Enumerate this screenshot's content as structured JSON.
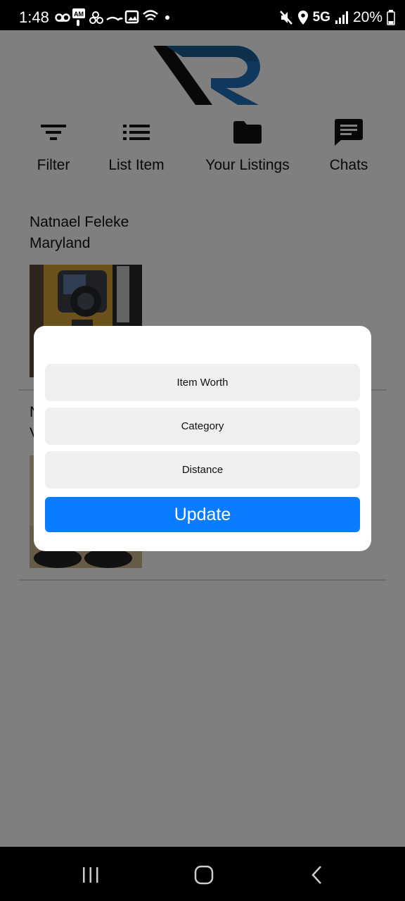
{
  "status_bar": {
    "time": "1:48",
    "network": "5G",
    "battery": "20%"
  },
  "nav": {
    "items": [
      {
        "label": "Filter",
        "icon": "filter-icon"
      },
      {
        "label": "List Item",
        "icon": "list-icon"
      },
      {
        "label": "Your Listings",
        "icon": "folder-icon"
      },
      {
        "label": "Chats",
        "icon": "chat-icon"
      }
    ]
  },
  "listings": [
    {
      "name": "Natnael Feleke",
      "location": "Maryland",
      "image": "camera-box photo"
    },
    {
      "name": "N",
      "location": "V",
      "image": "shoes photo"
    }
  ],
  "filter_dialog": {
    "options": [
      "Item Worth",
      "Category",
      "Distance"
    ],
    "update_label": "Update"
  },
  "colors": {
    "accent": "#0a7cff",
    "logo_blue": "#1f73b8",
    "logo_dark": "#111111"
  }
}
